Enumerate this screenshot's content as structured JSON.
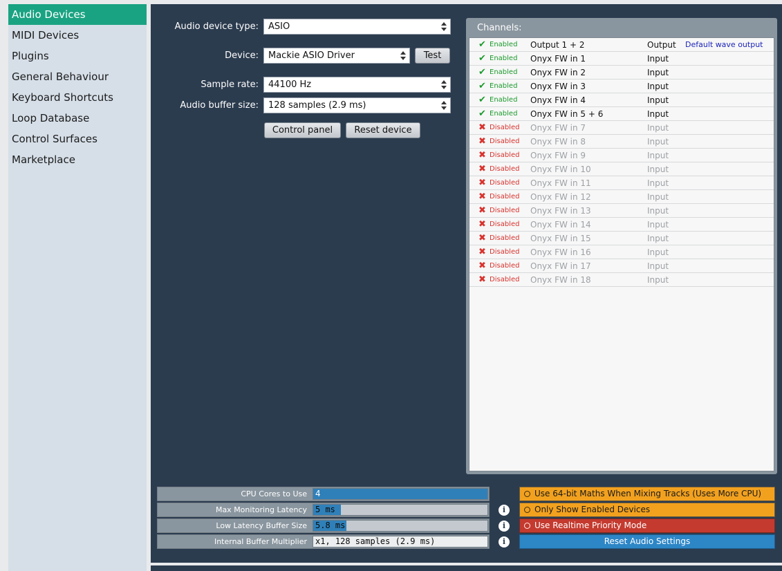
{
  "sidebar": {
    "items": [
      {
        "label": "Audio Devices"
      },
      {
        "label": "MIDI Devices"
      },
      {
        "label": "Plugins"
      },
      {
        "label": "General Behaviour"
      },
      {
        "label": "Keyboard Shortcuts"
      },
      {
        "label": "Loop Database"
      },
      {
        "label": "Control Surfaces"
      },
      {
        "label": "Marketplace"
      }
    ],
    "active_index": 0
  },
  "device_form": {
    "device_type_label": "Audio device type:",
    "device_type_value": "ASIO",
    "device_label": "Device:",
    "device_value": "Mackie ASIO Driver",
    "test_button": "Test",
    "sample_rate_label": "Sample rate:",
    "sample_rate_value": "44100 Hz",
    "buffer_size_label": "Audio buffer size:",
    "buffer_size_value": "128 samples (2.9 ms)",
    "control_panel_button": "Control panel",
    "reset_device_button": "Reset device"
  },
  "channels": {
    "title": "Channels:",
    "rows": [
      {
        "state": "Enabled",
        "name": "Output 1 + 2",
        "direction": "Output",
        "extra": "Default wave output"
      },
      {
        "state": "Enabled",
        "name": "Onyx FW in 1",
        "direction": "Input",
        "extra": ""
      },
      {
        "state": "Enabled",
        "name": "Onyx FW in 2",
        "direction": "Input",
        "extra": ""
      },
      {
        "state": "Enabled",
        "name": "Onyx FW in 3",
        "direction": "Input",
        "extra": ""
      },
      {
        "state": "Enabled",
        "name": "Onyx FW in 4",
        "direction": "Input",
        "extra": ""
      },
      {
        "state": "Enabled",
        "name": "Onyx FW in 5 + 6",
        "direction": "Input",
        "extra": ""
      },
      {
        "state": "Disabled",
        "name": "Onyx FW in 7",
        "direction": "Input",
        "extra": ""
      },
      {
        "state": "Disabled",
        "name": "Onyx FW in 8",
        "direction": "Input",
        "extra": ""
      },
      {
        "state": "Disabled",
        "name": "Onyx FW in 9",
        "direction": "Input",
        "extra": ""
      },
      {
        "state": "Disabled",
        "name": "Onyx FW in 10",
        "direction": "Input",
        "extra": ""
      },
      {
        "state": "Disabled",
        "name": "Onyx FW in 11",
        "direction": "Input",
        "extra": ""
      },
      {
        "state": "Disabled",
        "name": "Onyx FW in 12",
        "direction": "Input",
        "extra": ""
      },
      {
        "state": "Disabled",
        "name": "Onyx FW in 13",
        "direction": "Input",
        "extra": ""
      },
      {
        "state": "Disabled",
        "name": "Onyx FW in 14",
        "direction": "Input",
        "extra": ""
      },
      {
        "state": "Disabled",
        "name": "Onyx FW in 15",
        "direction": "Input",
        "extra": ""
      },
      {
        "state": "Disabled",
        "name": "Onyx FW in 16",
        "direction": "Input",
        "extra": ""
      },
      {
        "state": "Disabled",
        "name": "Onyx FW in 17",
        "direction": "Input",
        "extra": ""
      },
      {
        "state": "Disabled",
        "name": "Onyx FW in 18",
        "direction": "Input",
        "extra": ""
      }
    ]
  },
  "settings": {
    "cpu_cores": {
      "label": "CPU Cores to Use",
      "value": "4",
      "fill_fraction": 1.0
    },
    "max_monitoring_latency": {
      "label": "Max Monitoring Latency",
      "value": "5 ms",
      "fill_fraction": 0.16
    },
    "low_latency_buffer": {
      "label": "Low Latency Buffer Size",
      "value": "5.8 ms",
      "fill_fraction": 0.19
    },
    "internal_buffer_multiplier": {
      "label": "Internal Buffer Multiplier",
      "value": "x1, 128 samples (2.9 ms)"
    }
  },
  "toggles": {
    "use_64bit": "Use 64-bit Maths When Mixing Tracks (Uses More CPU)",
    "only_enabled": "Only Show Enabled Devices",
    "realtime_priority": "Use Realtime Priority Mode",
    "reset_audio": "Reset Audio Settings"
  },
  "colors": {
    "accent": "#1aa382",
    "panel_bg": "#2c3c4f",
    "enabled_green": "#1b9a2c",
    "disabled_red": "#d7332e",
    "slider_blue": "#2f80b9",
    "toggle_orange": "#f2a11f",
    "toggle_red": "#c43a2f",
    "reset_blue": "#2d86c6"
  },
  "icons": {
    "enabled": "check-icon",
    "disabled": "cross-icon",
    "info": "info-icon",
    "toggle": "radio-ring-icon"
  }
}
